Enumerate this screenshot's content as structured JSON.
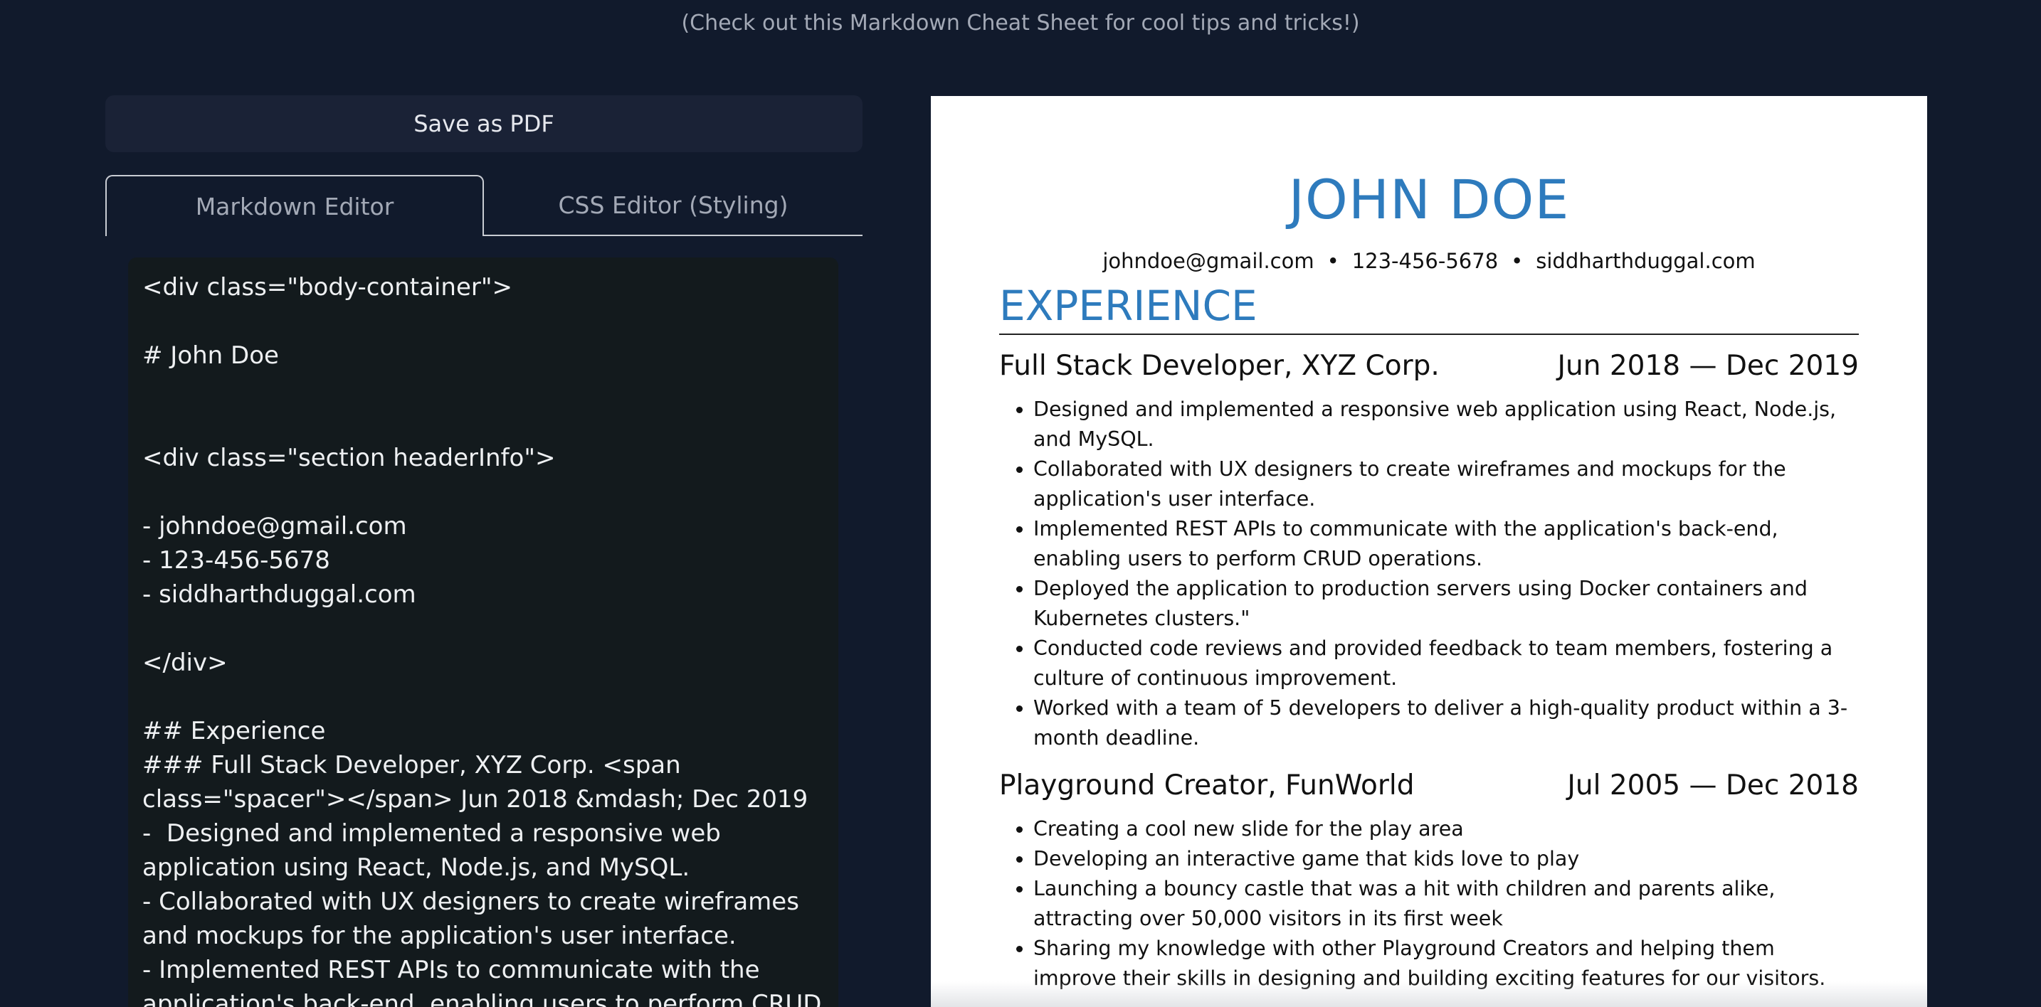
{
  "top_hint": {
    "prefix": "(Check out this ",
    "link": "Markdown Cheat Sheet",
    "suffix": " for cool tips and tricks!)"
  },
  "toolbar": {
    "save_label": "Save as PDF"
  },
  "tabs": [
    {
      "label": "Markdown Editor",
      "active": true
    },
    {
      "label": "CSS Editor (Styling)",
      "active": false
    }
  ],
  "editor": {
    "content": "<div class=\"body-container\">\n\n# John Doe\n\n\n<div class=\"section headerInfo\">\n\n- johndoe@gmail.com\n- 123-456-5678\n- siddharthduggal.com\n\n</div>\n\n## Experience\n### Full Stack Developer, XYZ Corp. <span class=\"spacer\"></span> Jun 2018 &mdash; Dec 2019\n-  Designed and implemented a responsive web application using React, Node.js, and MySQL.\n- Collaborated with UX designers to create wireframes and mockups for the application's user interface.\n- Implemented REST APIs to communicate with the application's back-end, enabling users to perform CRUD operations."
  },
  "resume": {
    "name": "JOHN DOE",
    "contact": [
      "johndoe@gmail.com",
      "123-456-5678",
      "siddharthduggal.com"
    ],
    "section_title": "EXPERIENCE",
    "jobs": [
      {
        "title": "Full Stack Developer, XYZ Corp.",
        "dates": "Jun 2018 — Dec 2019",
        "bullets": [
          "Designed and implemented a responsive web application using React, Node.js, and MySQL.",
          "Collaborated with UX designers to create wireframes and mockups for the application's user interface.",
          "Implemented REST APIs to communicate with the application's back-end, enabling users to perform CRUD operations.",
          "Deployed the application to production servers using Docker containers and Kubernetes clusters.\"",
          "Conducted code reviews and provided feedback to team members, fostering a culture of continuous improvement.",
          "Worked with a team of 5 developers to deliver a high-quality product within a 3-month deadline."
        ]
      },
      {
        "title": "Playground Creator, FunWorld",
        "dates": "Jul 2005 — Dec 2018",
        "bullets": [
          "Creating a cool new slide for the play area",
          "Developing an interactive game that kids love to play",
          "Launching a bouncy castle that was a hit with children and parents alike, attracting over 50,000 visitors in its first week",
          "Sharing my knowledge with other Playground Creators and helping them improve their skills in designing and building exciting features for our visitors."
        ]
      }
    ]
  },
  "colors": {
    "page_bg": "#111a2c",
    "button_bg": "#1a2236",
    "editor_bg": "#131a1d",
    "accent_blue": "#2e7bbd",
    "preview_bg": "#ffffff"
  }
}
